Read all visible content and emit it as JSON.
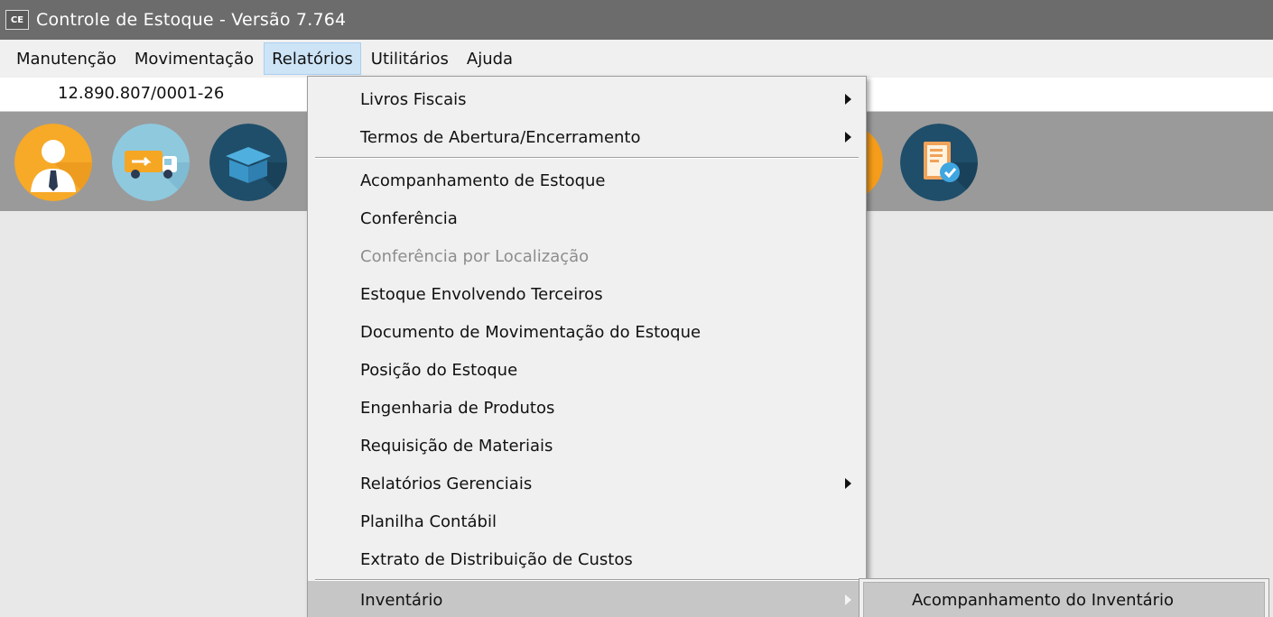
{
  "window": {
    "app_icon_text": "CE",
    "title": "Controle de Estoque - Versão 7.764"
  },
  "menubar": {
    "items": [
      {
        "label": "Manutenção"
      },
      {
        "label": "Movimentação"
      },
      {
        "label": "Relatórios",
        "active": true
      },
      {
        "label": "Utilitários"
      },
      {
        "label": "Ajuda"
      }
    ]
  },
  "company": {
    "cnpj": "12.890.807/0001-26"
  },
  "toolbar": {
    "icons": [
      "person-icon",
      "delivery-truck-icon",
      "box-icon",
      "orange-icon-partial",
      "report-check-icon"
    ]
  },
  "relatorios_menu": {
    "items": [
      {
        "label": "Livros Fiscais",
        "submenu": true
      },
      {
        "label": "Termos de Abertura/Encerramento",
        "submenu": true
      },
      {
        "label": "Acompanhamento de Estoque"
      },
      {
        "label": "Conferência"
      },
      {
        "label": "Conferência por Localização",
        "disabled": true
      },
      {
        "label": "Estoque Envolvendo Terceiros"
      },
      {
        "label": "Documento de Movimentação do Estoque"
      },
      {
        "label": "Posição do Estoque"
      },
      {
        "label": "Engenharia de Produtos"
      },
      {
        "label": "Requisição de Materiais"
      },
      {
        "label": "Relatórios Gerenciais",
        "submenu": true
      },
      {
        "label": "Planilha Contábil"
      },
      {
        "label": "Extrato de Distribuição de Custos"
      },
      {
        "label": "Inventário",
        "submenu": true,
        "highlighted": true
      }
    ]
  },
  "inventario_submenu": {
    "items": [
      {
        "label": "Acompanhamento do Inventário",
        "highlighted": true
      }
    ]
  },
  "colors": {
    "titlebar": "#6c6c6c",
    "menubar": "#f0f0f0",
    "toolbar": "#9a9a9a",
    "active_menu": "#cde4f7",
    "highlight": "#c6c6c6"
  }
}
